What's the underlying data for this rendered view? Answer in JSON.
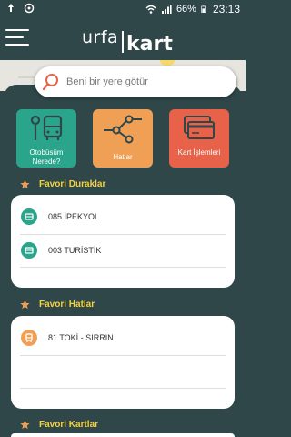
{
  "status": {
    "battery": "66%",
    "time": "23:13"
  },
  "header": {
    "logo_part1": "urfa",
    "logo_part2": "kart"
  },
  "search": {
    "placeholder": "Beni bir yere götür"
  },
  "tiles": [
    {
      "label": "Otobüsüm Nerede?",
      "color": "#2aa58c",
      "icon": "bus-stop-icon"
    },
    {
      "label": "Hatlar",
      "color": "#f0a055",
      "icon": "route-icon"
    },
    {
      "label": "Kart İşlemleri",
      "color": "#e8624a",
      "icon": "cards-icon"
    }
  ],
  "favorites_stops": {
    "title": "Favori Duraklar",
    "items": [
      {
        "label": "085  İPEKYOL",
        "icon": "bus-stop-icon"
      },
      {
        "label": "003 TURİSTİK",
        "icon": "bus-stop-icon"
      }
    ]
  },
  "favorites_lines": {
    "title": "Favori Hatlar",
    "items": [
      {
        "label": "81 TOKİ - SIRRIN",
        "icon": "bus-icon"
      }
    ]
  },
  "favorites_cards": {
    "title": "Favori Kartlar"
  },
  "colors": {
    "background": "#2f4749",
    "accent_yellow": "#f5d13b",
    "green": "#2aa58c",
    "orange": "#f0a055",
    "red": "#e8624a"
  }
}
